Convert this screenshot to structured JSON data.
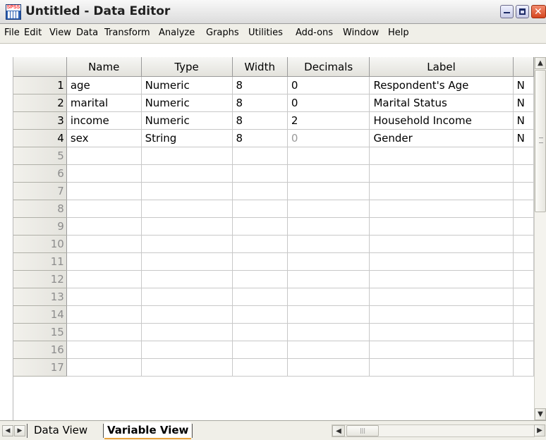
{
  "window": {
    "title": "Untitled - Data Editor",
    "icon_label": "SPSS",
    "close_glyph": "✕"
  },
  "menu": [
    "File",
    "Edit",
    "View",
    "Data",
    "Transform",
    "Analyze",
    "Graphs",
    "Utilities",
    "Add-ons",
    "Window",
    "Help"
  ],
  "grid": {
    "columns": [
      "Name",
      "Type",
      "Width",
      "Decimals",
      "Label"
    ],
    "rows": [
      {
        "num": "1",
        "name": "age",
        "type": "Numeric",
        "width": "8",
        "decimals": "0",
        "label": "Respondent's Age",
        "extra": "N"
      },
      {
        "num": "2",
        "name": "marital",
        "type": "Numeric",
        "width": "8",
        "decimals": "0",
        "label": "Marital Status",
        "extra": "N"
      },
      {
        "num": "3",
        "name": "income",
        "type": "Numeric",
        "width": "8",
        "decimals": "2",
        "label": "Household Income",
        "extra": "N"
      },
      {
        "num": "4",
        "name": "sex",
        "type": "String",
        "width": "8",
        "decimals": "0",
        "label": "Gender",
        "extra": "N"
      }
    ],
    "empty_rows": [
      "5",
      "6",
      "7",
      "8",
      "9",
      "10",
      "11",
      "12",
      "13",
      "14",
      "15",
      "16",
      "17"
    ]
  },
  "tabs": {
    "data_view": "Data View",
    "variable_view": "Variable View",
    "active": "Variable View"
  },
  "icons": {
    "scroll_up": "▲",
    "scroll_down": "▼",
    "scroll_left": "◀",
    "scroll_right": "▶",
    "first_sheet": "◀",
    "last_sheet": "▶"
  },
  "colors": {
    "active_tab_underline": "#e8a23c",
    "close_button": "#d5451f"
  }
}
